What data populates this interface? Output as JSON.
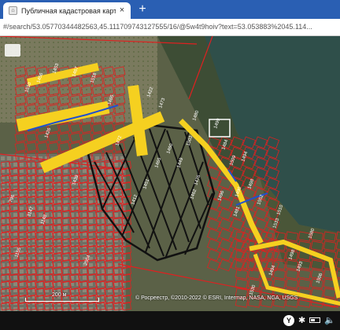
{
  "browser": {
    "tab_title": "Публичная кадастровая карта",
    "tab_close": "×",
    "new_tab": "+",
    "url": "#/search/53.05770344482563,45.111709743127555/16/@5w4t9hoiv?text=53.053883%2045.114..."
  },
  "map": {
    "colors": {
      "parcel_border": "#e02020",
      "yellow_zone": "#f5d020",
      "black_grid": "#111111",
      "blue_line": "#2050d0",
      "water": "#2f4f4a",
      "forest": "#2f4a2f"
    },
    "parcel_labels": [
      "1422",
      "1473",
      "1465",
      "1518",
      "1467",
      "1453",
      "1456",
      "1510",
      "1472",
      "1426",
      "1480",
      "1499",
      "1460",
      "1449",
      "1503",
      "1475",
      "1484",
      "1509",
      "1494",
      "1496",
      "1481",
      "1552",
      "1533",
      "1580",
      "2504",
      "1155",
      "796",
      "1147",
      "1148",
      "1462",
      "1490",
      "1498",
      "1510",
      "1412",
      "1451",
      "1465",
      "1439",
      "1498",
      "1494",
      "1493",
      "1506",
      "1530"
    ],
    "scale_label": "200 м",
    "attribution": "© Росреестр, ©2010-2022 © ESRI, Intermap, NASA, NGA, USGS"
  },
  "taskbar": {
    "tray_badge": "Y",
    "bluetooth_icon": "✱",
    "volume_icon": "🔈"
  }
}
